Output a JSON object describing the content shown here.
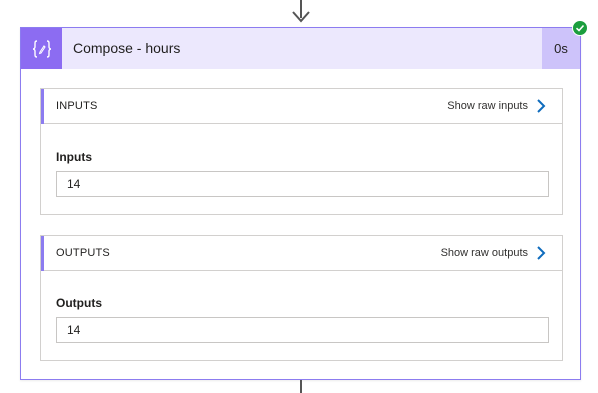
{
  "action": {
    "title": "Compose - hours",
    "duration": "0s",
    "icon": "compose-braces-icon",
    "status_icon": "success-check-icon",
    "accent_color": "#8c6cf2",
    "header_color": "#ece8fd",
    "duration_bg_color": "#cdc3fa",
    "status_color": "#1b9e3e"
  },
  "inputs": {
    "section_title": "INPUTS",
    "raw_link_label": "Show raw inputs",
    "field_label": "Inputs",
    "field_value": "14"
  },
  "outputs": {
    "section_title": "OUTPUTS",
    "raw_link_label": "Show raw outputs",
    "field_label": "Outputs",
    "field_value": "14"
  },
  "link_color": "#0f6cbd"
}
